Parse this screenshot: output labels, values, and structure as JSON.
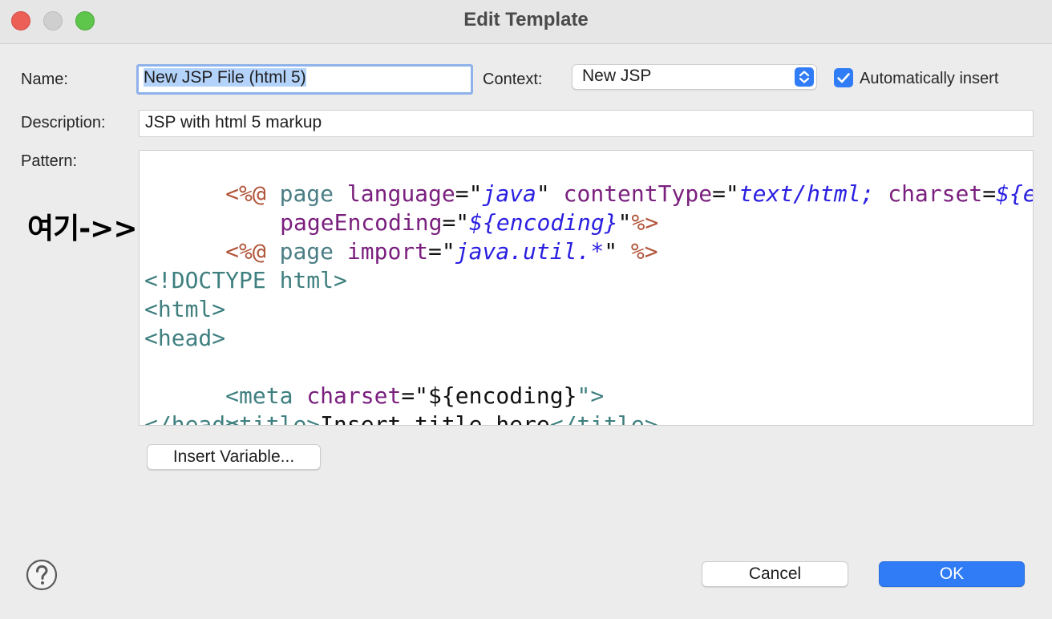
{
  "window": {
    "title": "Edit Template"
  },
  "form": {
    "name_label": "Name:",
    "name_value": "New JSP File (html 5)",
    "context_label": "Context:",
    "context_value": "New JSP",
    "auto_insert_label": "Automatically insert",
    "auto_insert_checked": true,
    "description_label": "Description:",
    "description_value": "JSP with html 5 markup",
    "pattern_label": "Pattern:"
  },
  "annotation": {
    "text": "여기->>"
  },
  "pattern_code": {
    "lines": [
      [
        "<%@",
        " page ",
        "language",
        "=\"",
        "java",
        "\" ",
        "contentType",
        "=\"",
        "text/html; ",
        "charset",
        "=",
        "${enc"
      ],
      [
        "pageEncoding",
        "=\"",
        "${encoding}",
        "\"",
        "%>"
      ],
      [
        "<%@",
        " page ",
        "import",
        "=\"",
        "java.util.*",
        "\" ",
        "%>"
      ],
      [
        "<!DOCTYPE html>"
      ],
      [
        "<html>"
      ],
      [
        "<head>"
      ],
      [
        "<meta ",
        "charset",
        "=\"",
        "${encoding}",
        "\">"
      ],
      [
        "<title>",
        "Insert title here",
        "</title>"
      ],
      [
        "</head>"
      ]
    ]
  },
  "buttons": {
    "insert_variable": "Insert Variable...",
    "cancel": "Cancel",
    "ok": "OK"
  },
  "colors": {
    "accent": "#2f7cf6",
    "directive": "#b0553a",
    "attribute": "#7a1f7e",
    "string": "#2a1fe0",
    "tag": "#3f7f7f"
  }
}
